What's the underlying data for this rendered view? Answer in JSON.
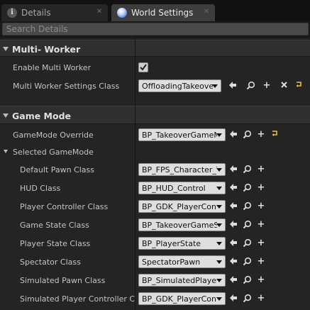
{
  "tabs": [
    {
      "label": "Details",
      "icon": "info-icon",
      "active": false
    },
    {
      "label": "World Settings",
      "icon": "world-globe-icon",
      "active": true
    }
  ],
  "search": {
    "placeholder": "Search Details"
  },
  "categories": [
    {
      "name": "Multi- Worker"
    },
    {
      "name": "Game Mode"
    }
  ],
  "multi_worker": {
    "enable_label": "Enable Multi Worker",
    "enable_checked": true,
    "settings_label": "Multi Worker Settings Class",
    "settings_value": "OffloadingTakeover"
  },
  "game_mode": {
    "override_label": "GameMode Override",
    "override_value": "BP_TakeoverGameM",
    "selected_label": "Selected GameMode",
    "props": [
      {
        "label": "Default Pawn Class",
        "value": "BP_FPS_Character_T"
      },
      {
        "label": "HUD Class",
        "value": "BP_HUD_Control"
      },
      {
        "label": "Player Controller Class",
        "value": "BP_GDK_PlayerContr"
      },
      {
        "label": "Game State Class",
        "value": "BP_TakeoverGameSt"
      },
      {
        "label": "Player State Class",
        "value": "BP_PlayerState"
      },
      {
        "label": "Spectator Class",
        "value": "SpectatorPawn"
      },
      {
        "label": "Simulated Pawn Class",
        "value": "BP_SimulatedPlayer("
      },
      {
        "label": "Simulated Player Controller Clas",
        "value": "BP_GDK_PlayerContr"
      }
    ]
  },
  "colors": {
    "reset_arrow": "#e8c23a",
    "background": "#242424",
    "combo": "#dedede"
  }
}
